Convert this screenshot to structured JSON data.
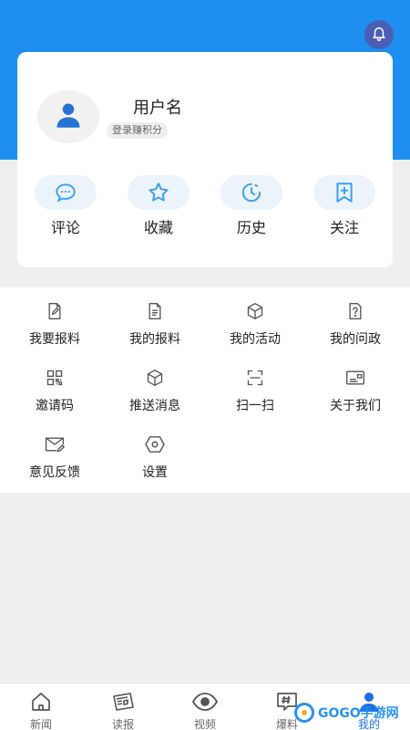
{
  "header": {
    "bell_icon": "bell-icon",
    "header_color": "#1e8ff0"
  },
  "profile": {
    "username": "用户名",
    "login_hint": "登录赚积分",
    "avatar_icon": "user-icon"
  },
  "quick_actions": [
    {
      "label": "评论",
      "icon": "comment-icon"
    },
    {
      "label": "收藏",
      "icon": "star-icon"
    },
    {
      "label": "历史",
      "icon": "clock-icon"
    },
    {
      "label": "关注",
      "icon": "bookmark-plus-icon"
    }
  ],
  "menu": [
    {
      "label": "我要报料",
      "icon": "edit-document-icon"
    },
    {
      "label": "我的报料",
      "icon": "document-icon"
    },
    {
      "label": "我的活动",
      "icon": "cube-icon"
    },
    {
      "label": "我的问政",
      "icon": "question-document-icon"
    },
    {
      "label": "邀请码",
      "icon": "qr-code-icon"
    },
    {
      "label": "推送消息",
      "icon": "cube-icon"
    },
    {
      "label": "扫一扫",
      "icon": "scan-icon"
    },
    {
      "label": "关于我们",
      "icon": "id-card-icon"
    },
    {
      "label": "意见反馈",
      "icon": "mail-edit-icon"
    },
    {
      "label": "设置",
      "icon": "settings-hexagon-icon"
    }
  ],
  "tabbar": [
    {
      "label": "新闻",
      "icon": "home-icon",
      "active": false
    },
    {
      "label": "读报",
      "icon": "newspaper-icon",
      "active": false
    },
    {
      "label": "视频",
      "icon": "eye-icon",
      "active": false
    },
    {
      "label": "爆料",
      "icon": "hashtag-icon",
      "active": false
    },
    {
      "label": "我的",
      "icon": "user-icon",
      "active": true
    }
  ],
  "watermark": {
    "text": "GOGO手游网"
  },
  "colors": {
    "accent": "#1e8ff0",
    "icon_blue": "#3aa0f0",
    "active_tab": "#1e6fe0"
  }
}
